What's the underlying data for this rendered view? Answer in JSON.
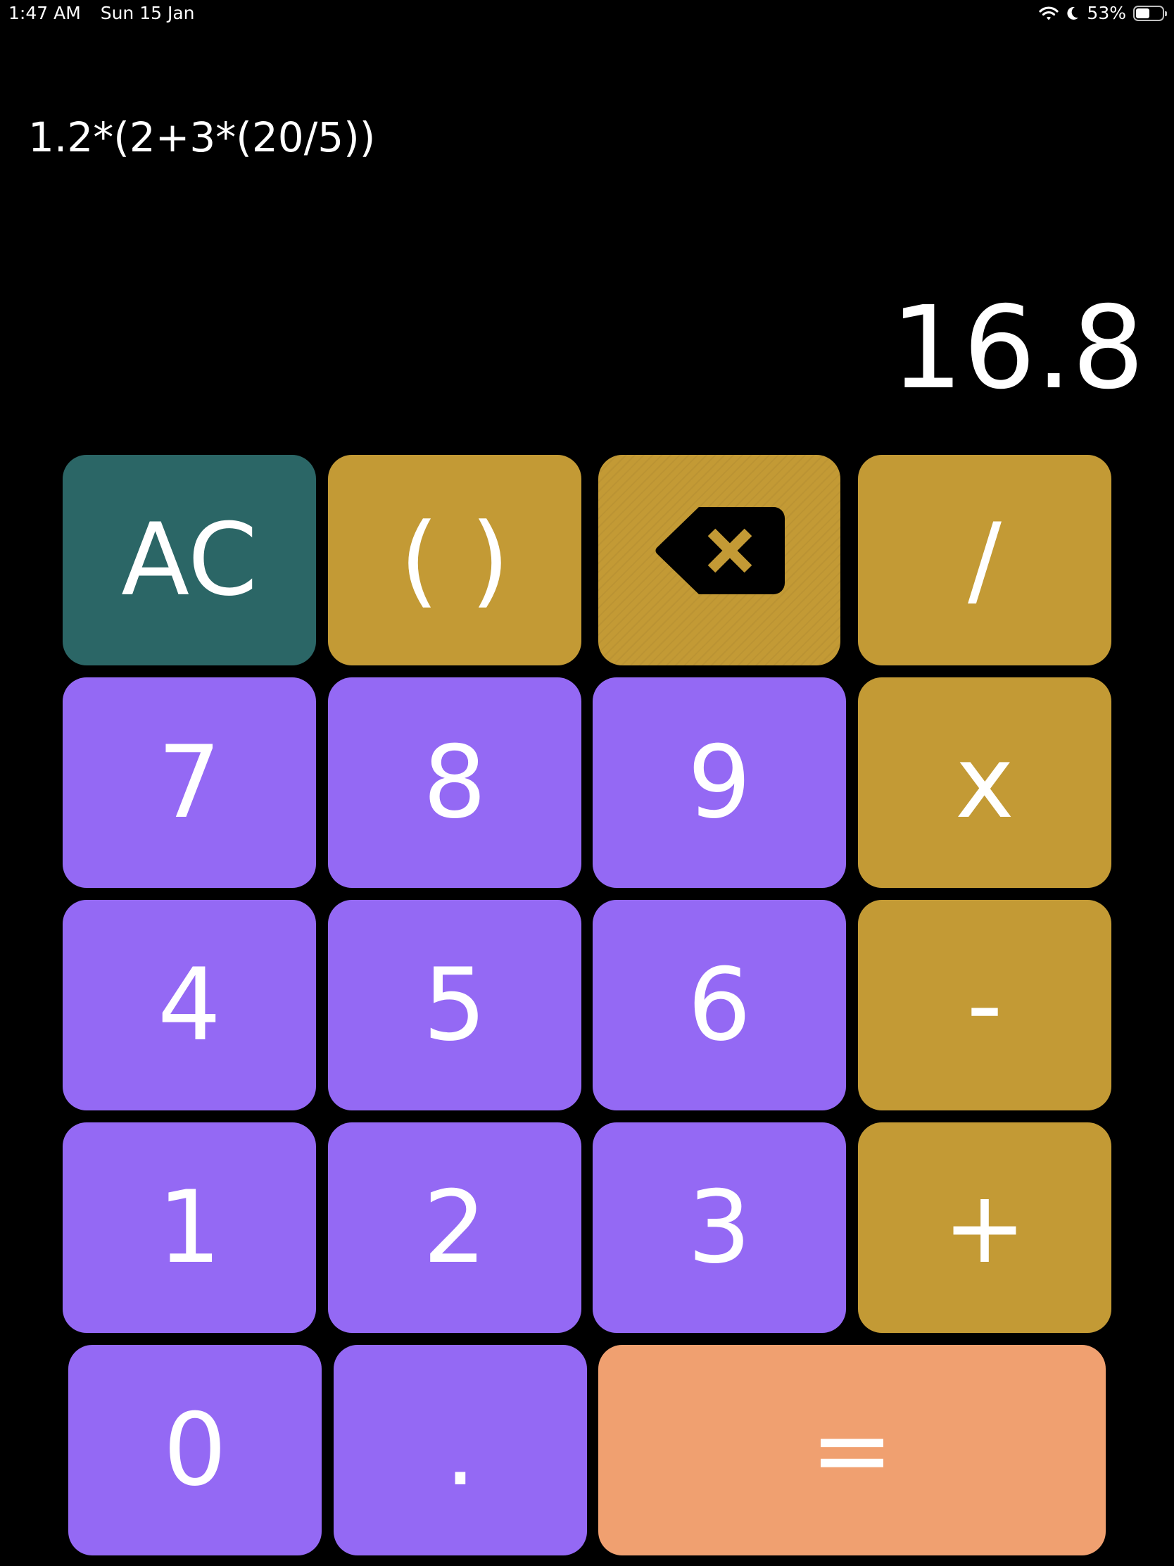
{
  "status_bar": {
    "time": "1:47 AM",
    "date": "Sun 15 Jan",
    "battery_percent": "53%",
    "battery_level": 0.53,
    "icons": [
      "wifi-icon",
      "moon-icon",
      "battery-icon"
    ]
  },
  "display": {
    "expression": "1.2*(2+3*(20/5))",
    "result": "16.8"
  },
  "keys": {
    "ac": "AC",
    "parens": "( )",
    "backspace_icon": "backspace-icon",
    "divide": "/",
    "seven": "7",
    "eight": "8",
    "nine": "9",
    "multiply": "x",
    "four": "4",
    "five": "5",
    "six": "6",
    "subtract": "-",
    "one": "1",
    "two": "2",
    "three": "3",
    "add": "+",
    "zero": "0",
    "decimal": ".",
    "equals": "="
  },
  "colors": {
    "background": "#000000",
    "number_key": "#9469f4",
    "operator_key": "#c39a35",
    "clear_key": "#2b6666",
    "equals_key": "#f0a070",
    "text": "#ffffff"
  }
}
